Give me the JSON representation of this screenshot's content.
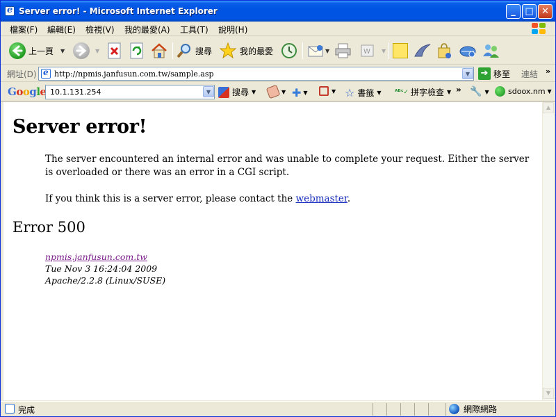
{
  "window": {
    "title": "Server error! - Microsoft Internet Explorer",
    "buttons": {
      "minimize": "_",
      "maximize": "□",
      "close": "✕"
    }
  },
  "menu": {
    "items": [
      "檔案(F)",
      "編輯(E)",
      "檢視(V)",
      "我的最愛(A)",
      "工具(T)",
      "說明(H)"
    ]
  },
  "toolbar": {
    "back_label": "上一頁",
    "search_label": "搜尋",
    "favorites_label": "我的最愛"
  },
  "address": {
    "label": "網址(D)",
    "url": "http://npmis.janfusun.com.tw/sample.asp",
    "go_label": "移至",
    "links_label": "連結"
  },
  "google": {
    "logo": "Google",
    "query": "10.1.131.254",
    "search_label": "搜尋",
    "bookmarks_label": "書籤",
    "spellcheck_label": "拼字檢查",
    "account_label": "sdoox.nm"
  },
  "page": {
    "heading": "Server error!",
    "para1": "The server encountered an internal error and was unable to complete your request. Either the server is overloaded or there was an error in a CGI script.",
    "para2_prefix": "If you think this is a server error, please contact the ",
    "para2_link": "webmaster",
    "para2_suffix": ".",
    "code_heading": "Error 500",
    "host_link": "npmis.janfusun.com.tw",
    "date": "Tue Nov 3 16:24:04 2009",
    "server": "Apache/2.2.8 (Linux/SUSE)"
  },
  "status": {
    "text": "完成",
    "zone": "網際網路"
  }
}
